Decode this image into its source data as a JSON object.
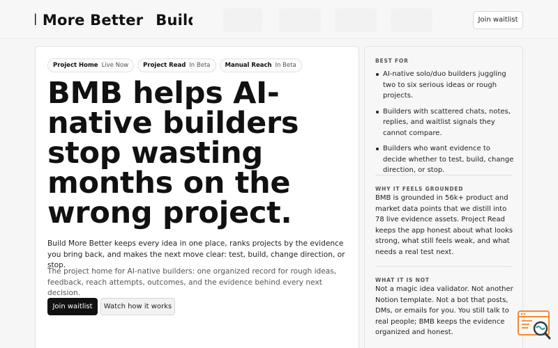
{
  "header": {
    "brand_text": "Build More Better",
    "join_label": "Join waitlist"
  },
  "pills": [
    {
      "name": "Project Home",
      "status": "Live Now"
    },
    {
      "name": "Project Read",
      "status": "In Beta"
    },
    {
      "name": "Manual Reach",
      "status": "In Beta"
    }
  ],
  "hero": {
    "headline": "BMB helps AI-native builders stop wasting months on the wrong project.",
    "lead": "Build More Better keeps every idea in one place, ranks projects by the evidence you bring back, and makes the next move clear: test, build, change direction, or stop.",
    "sub": "The project home for AI-native builders: one organized record for rough ideas, feedback, reach attempts, outcomes, and the evidence behind every next decision.",
    "primary_cta": "Join waitlist",
    "secondary_cta": "Watch how it works"
  },
  "side": {
    "best_for_label": "BEST FOR",
    "best_for": [
      "AI-native solo/duo builders juggling two to six serious ideas or rough projects.",
      "Builders with scattered chats, notes, replies, and waitlist signals they cannot compare.",
      "Builders who want evidence to decide whether to test, build, change direction, or stop."
    ],
    "grounded_label": "WHY IT FEELS GROUNDED",
    "grounded_text": "BMB is grounded in 56k+ product and market data points that we distill into 78 live evidence assets. Project Read keeps the app honest about what looks strong, what still feels weak, and what needs a real test next.",
    "not_label": "WHAT IT IS NOT",
    "not_text": "Not a magic idea validator. Not another Notion template. Not a bot that posts, DMs, or emails for you. You still talk to real people; BMB keeps the evidence organized and honest."
  },
  "icons": {
    "widget": "search-window-icon",
    "widget_color": "#f08a3c"
  }
}
